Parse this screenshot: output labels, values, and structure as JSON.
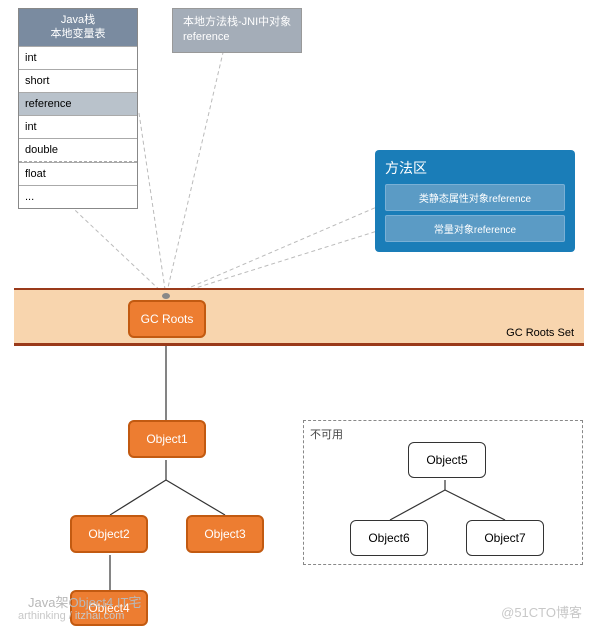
{
  "javaStack": {
    "headerLine1": "Java栈",
    "headerLine2": "本地变量表",
    "rows": [
      "int",
      "short",
      "reference",
      "int",
      "double",
      "float",
      "..."
    ],
    "highlightIndex": 2,
    "dashedAfter": 4
  },
  "jniBox": {
    "line1": "本地方法栈-JNI中对象",
    "line2": "reference"
  },
  "methodArea": {
    "title": "方法区",
    "items": [
      "类静态属性对象reference",
      "常量对象reference"
    ]
  },
  "gcBand": {
    "label": "GC Roots Set"
  },
  "nodes": {
    "gcRoots": "GC Roots",
    "object1": "Object1",
    "object2": "Object2",
    "object3": "Object3",
    "object4": "Object4",
    "object5": "Object5",
    "object6": "Object6",
    "object7": "Object7"
  },
  "unreachable": {
    "label": "不可用"
  },
  "watermarks": {
    "w1": "Java架Object4 IT宅",
    "w2": "arthinking / itzhai.com",
    "w3": "@51CTO博客"
  }
}
